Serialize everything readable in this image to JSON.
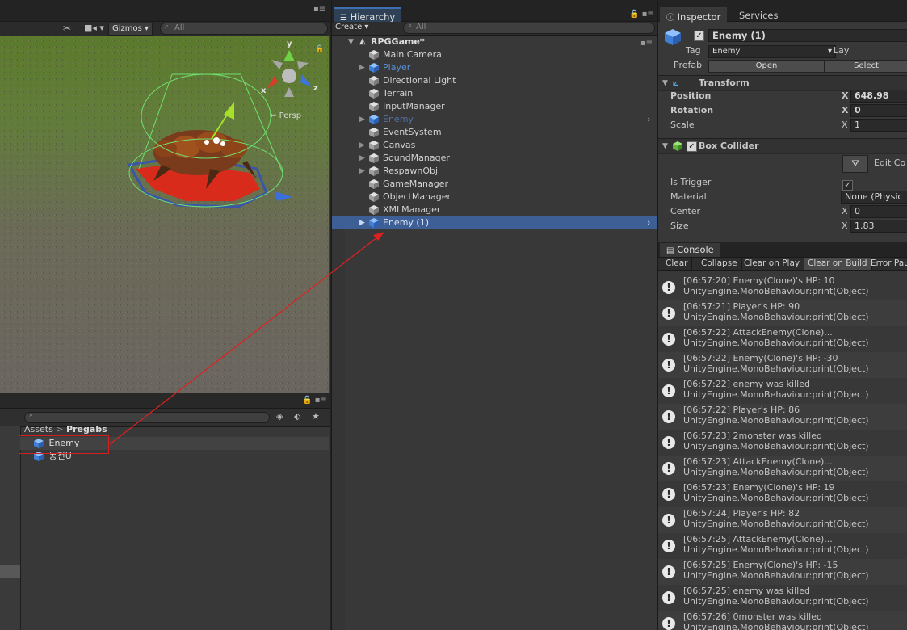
{
  "scene": {
    "toolbar": {
      "gizmos_label": "Gizmos",
      "search_placeholder": "All"
    },
    "gizmo": {
      "y": "y",
      "x": "x",
      "z": "z",
      "persp": "Persp"
    }
  },
  "project": {
    "search_placeholder": "",
    "breadcrumb": {
      "root": "Assets",
      "sep": ">",
      "folder": "Pregabs"
    },
    "assets": [
      {
        "label": "Enemy"
      },
      {
        "label": "동전U"
      }
    ]
  },
  "hierarchy": {
    "tab_label": "Hierarchy",
    "create_label": "Create",
    "search_placeholder": "All",
    "scene_name": "RPGGame*",
    "items": [
      {
        "label": "Main Camera"
      },
      {
        "label": "Player"
      },
      {
        "label": "Directional Light"
      },
      {
        "label": "Terrain"
      },
      {
        "label": "InputManager"
      },
      {
        "label": "Enemy"
      },
      {
        "label": "EventSystem"
      },
      {
        "label": "Canvas"
      },
      {
        "label": "SoundManager"
      },
      {
        "label": "RespawnObj"
      },
      {
        "label": "GameManager"
      },
      {
        "label": "ObjectManager"
      },
      {
        "label": "XMLManager"
      },
      {
        "label": "Enemy (1)"
      }
    ]
  },
  "inspector": {
    "tab_label": "Inspector",
    "services_label": "Services",
    "object_name": "Enemy (1)",
    "tag_label": "Tag",
    "tag_value": "Enemy",
    "layer_label": "Lay",
    "prefab_label": "Prefab",
    "open_label": "Open",
    "select_label": "Select",
    "transform": {
      "title": "Transform",
      "position_label": "Position",
      "position_x": "648.98",
      "rotation_label": "Rotation",
      "rotation_x": "0",
      "scale_label": "Scale",
      "scale_x": "1",
      "axis_x": "X"
    },
    "box_collider": {
      "title": "Box Collider",
      "edit_label": "Edit Co",
      "is_trigger_label": "Is Trigger",
      "material_label": "Material",
      "material_value": "None (Physic",
      "center_label": "Center",
      "center_x": "0",
      "size_label": "Size",
      "size_x": "1.83"
    }
  },
  "console": {
    "tab_label": "Console",
    "buttons": [
      "Clear",
      "Collapse",
      "Clear on Play",
      "Clear on Build",
      "Error Pau"
    ],
    "logs": [
      {
        "line1": "[06:57:20] Enemy(Clone)'s HP: 10",
        "line2": "UnityEngine.MonoBehaviour:print(Object)"
      },
      {
        "line1": "[06:57:21] Player's HP: 90",
        "line2": "UnityEngine.MonoBehaviour:print(Object)"
      },
      {
        "line1": "[06:57:22] AttackEnemy(Clone)...",
        "line2": "UnityEngine.MonoBehaviour:print(Object)"
      },
      {
        "line1": "[06:57:22] Enemy(Clone)'s HP: -30",
        "line2": "UnityEngine.MonoBehaviour:print(Object)"
      },
      {
        "line1": "[06:57:22] enemy was killed",
        "line2": "UnityEngine.MonoBehaviour:print(Object)"
      },
      {
        "line1": "[06:57:22] Player's HP: 86",
        "line2": "UnityEngine.MonoBehaviour:print(Object)"
      },
      {
        "line1": "[06:57:23] 2monster was killed",
        "line2": "UnityEngine.MonoBehaviour:print(Object)"
      },
      {
        "line1": "[06:57:23] AttackEnemy(Clone)...",
        "line2": "UnityEngine.MonoBehaviour:print(Object)"
      },
      {
        "line1": "[06:57:23] Enemy(Clone)'s HP: 19",
        "line2": "UnityEngine.MonoBehaviour:print(Object)"
      },
      {
        "line1": "[06:57:24] Player's HP: 82",
        "line2": "UnityEngine.MonoBehaviour:print(Object)"
      },
      {
        "line1": "[06:57:25] AttackEnemy(Clone)...",
        "line2": "UnityEngine.MonoBehaviour:print(Object)"
      },
      {
        "line1": "[06:57:25] Enemy(Clone)'s HP: -15",
        "line2": "UnityEngine.MonoBehaviour:print(Object)"
      },
      {
        "line1": "[06:57:25] enemy was killed",
        "line2": "UnityEngine.MonoBehaviour:print(Object)"
      },
      {
        "line1": "[06:57:26] 0monster was killed",
        "line2": "UnityEngine.MonoBehaviour:print(Object)"
      }
    ]
  },
  "colors": {
    "selection": "#3e5f96",
    "prefab_blue": "#5c8fd6",
    "prefab_blue_dim": "#5470a3",
    "annotation_red": "#e02020"
  }
}
